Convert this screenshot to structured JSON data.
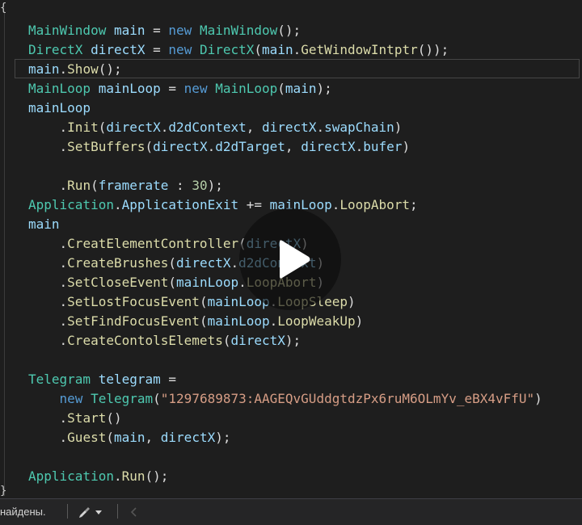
{
  "editor": {
    "lines": [
      {
        "id": "line-1",
        "current": false,
        "tokens": [
          {
            "c": "type",
            "t": "MainWindow"
          },
          {
            "c": "punc",
            "t": " "
          },
          {
            "c": "var",
            "t": "main"
          },
          {
            "c": "punc",
            "t": " = "
          },
          {
            "c": "kw",
            "t": "new"
          },
          {
            "c": "punc",
            "t": " "
          },
          {
            "c": "type",
            "t": "MainWindow"
          },
          {
            "c": "punc",
            "t": "();"
          }
        ]
      },
      {
        "id": "line-2",
        "current": false,
        "tokens": [
          {
            "c": "type",
            "t": "DirectX"
          },
          {
            "c": "punc",
            "t": " "
          },
          {
            "c": "var",
            "t": "directX"
          },
          {
            "c": "punc",
            "t": " = "
          },
          {
            "c": "kw",
            "t": "new"
          },
          {
            "c": "punc",
            "t": " "
          },
          {
            "c": "type",
            "t": "DirectX"
          },
          {
            "c": "punc",
            "t": "("
          },
          {
            "c": "var",
            "t": "main"
          },
          {
            "c": "punc",
            "t": "."
          },
          {
            "c": "meth",
            "t": "GetWindowIntptr"
          },
          {
            "c": "punc",
            "t": "());"
          }
        ]
      },
      {
        "id": "line-3",
        "current": true,
        "tokens": [
          {
            "c": "var",
            "t": "main"
          },
          {
            "c": "punc",
            "t": "."
          },
          {
            "c": "meth",
            "t": "Show"
          },
          {
            "c": "punc",
            "t": "();"
          }
        ]
      },
      {
        "id": "line-4",
        "current": false,
        "tokens": [
          {
            "c": "type",
            "t": "MainLoop"
          },
          {
            "c": "punc",
            "t": " "
          },
          {
            "c": "var",
            "t": "mainLoop"
          },
          {
            "c": "punc",
            "t": " = "
          },
          {
            "c": "kw",
            "t": "new"
          },
          {
            "c": "punc",
            "t": " "
          },
          {
            "c": "type",
            "t": "MainLoop"
          },
          {
            "c": "punc",
            "t": "("
          },
          {
            "c": "var",
            "t": "main"
          },
          {
            "c": "punc",
            "t": ");"
          }
        ]
      },
      {
        "id": "line-5",
        "current": false,
        "tokens": [
          {
            "c": "var",
            "t": "mainLoop"
          }
        ]
      },
      {
        "id": "line-6",
        "current": false,
        "tokens": [
          {
            "c": "punc",
            "t": "    ."
          },
          {
            "c": "meth",
            "t": "Init"
          },
          {
            "c": "punc",
            "t": "("
          },
          {
            "c": "var",
            "t": "directX"
          },
          {
            "c": "punc",
            "t": "."
          },
          {
            "c": "var",
            "t": "d2dContext"
          },
          {
            "c": "punc",
            "t": ", "
          },
          {
            "c": "var",
            "t": "directX"
          },
          {
            "c": "punc",
            "t": "."
          },
          {
            "c": "var",
            "t": "swapChain"
          },
          {
            "c": "punc",
            "t": ")"
          }
        ]
      },
      {
        "id": "line-7",
        "current": false,
        "tokens": [
          {
            "c": "punc",
            "t": "    ."
          },
          {
            "c": "meth",
            "t": "SetBuffers"
          },
          {
            "c": "punc",
            "t": "("
          },
          {
            "c": "var",
            "t": "directX"
          },
          {
            "c": "punc",
            "t": "."
          },
          {
            "c": "var",
            "t": "d2dTarget"
          },
          {
            "c": "punc",
            "t": ", "
          },
          {
            "c": "var",
            "t": "directX"
          },
          {
            "c": "punc",
            "t": "."
          },
          {
            "c": "var",
            "t": "bufer"
          },
          {
            "c": "punc",
            "t": ")"
          }
        ]
      },
      {
        "id": "line-8",
        "current": false,
        "tokens": []
      },
      {
        "id": "line-9",
        "current": false,
        "tokens": [
          {
            "c": "punc",
            "t": "    ."
          },
          {
            "c": "meth",
            "t": "Run"
          },
          {
            "c": "punc",
            "t": "("
          },
          {
            "c": "var",
            "t": "framerate"
          },
          {
            "c": "punc",
            "t": " : "
          },
          {
            "c": "num",
            "t": "30"
          },
          {
            "c": "punc",
            "t": ");"
          }
        ]
      },
      {
        "id": "line-10",
        "current": false,
        "tokens": [
          {
            "c": "type",
            "t": "Application"
          },
          {
            "c": "punc",
            "t": "."
          },
          {
            "c": "var",
            "t": "ApplicationExit"
          },
          {
            "c": "punc",
            "t": " += "
          },
          {
            "c": "var",
            "t": "mainLoop"
          },
          {
            "c": "punc",
            "t": "."
          },
          {
            "c": "meth",
            "t": "LoopAbort"
          },
          {
            "c": "punc",
            "t": ";"
          }
        ]
      },
      {
        "id": "line-11",
        "current": false,
        "tokens": [
          {
            "c": "var",
            "t": "main"
          }
        ]
      },
      {
        "id": "line-12",
        "current": false,
        "tokens": [
          {
            "c": "punc",
            "t": "    ."
          },
          {
            "c": "meth",
            "t": "CreatElementController"
          },
          {
            "c": "punc",
            "t": "("
          },
          {
            "c": "var",
            "t": "directX"
          },
          {
            "c": "punc",
            "t": ")"
          }
        ]
      },
      {
        "id": "line-13",
        "current": false,
        "tokens": [
          {
            "c": "punc",
            "t": "    ."
          },
          {
            "c": "meth",
            "t": "CreateBrushes"
          },
          {
            "c": "punc",
            "t": "("
          },
          {
            "c": "var",
            "t": "directX"
          },
          {
            "c": "punc",
            "t": "."
          },
          {
            "c": "var",
            "t": "d2dContext"
          },
          {
            "c": "punc",
            "t": ")"
          }
        ]
      },
      {
        "id": "line-14",
        "current": false,
        "tokens": [
          {
            "c": "punc",
            "t": "    ."
          },
          {
            "c": "meth",
            "t": "SetCloseEvent"
          },
          {
            "c": "punc",
            "t": "("
          },
          {
            "c": "var",
            "t": "mainLoop"
          },
          {
            "c": "punc",
            "t": "."
          },
          {
            "c": "meth",
            "t": "LoopAbort"
          },
          {
            "c": "punc",
            "t": ")"
          }
        ]
      },
      {
        "id": "line-15",
        "current": false,
        "tokens": [
          {
            "c": "punc",
            "t": "    ."
          },
          {
            "c": "meth",
            "t": "SetLostFocusEvent"
          },
          {
            "c": "punc",
            "t": "("
          },
          {
            "c": "var",
            "t": "mainLoop"
          },
          {
            "c": "punc",
            "t": "."
          },
          {
            "c": "meth",
            "t": "LoopSleep"
          },
          {
            "c": "punc",
            "t": ")"
          }
        ]
      },
      {
        "id": "line-16",
        "current": false,
        "tokens": [
          {
            "c": "punc",
            "t": "    ."
          },
          {
            "c": "meth",
            "t": "SetFindFocusEvent"
          },
          {
            "c": "punc",
            "t": "("
          },
          {
            "c": "var",
            "t": "mainLoop"
          },
          {
            "c": "punc",
            "t": "."
          },
          {
            "c": "meth",
            "t": "LoopWeakUp"
          },
          {
            "c": "punc",
            "t": ")"
          }
        ]
      },
      {
        "id": "line-17",
        "current": false,
        "tokens": [
          {
            "c": "punc",
            "t": "    ."
          },
          {
            "c": "meth",
            "t": "CreateContolsElemets"
          },
          {
            "c": "punc",
            "t": "("
          },
          {
            "c": "var",
            "t": "directX"
          },
          {
            "c": "punc",
            "t": ");"
          }
        ]
      },
      {
        "id": "line-18",
        "current": false,
        "tokens": []
      },
      {
        "id": "line-19",
        "current": false,
        "tokens": [
          {
            "c": "type",
            "t": "Telegram"
          },
          {
            "c": "punc",
            "t": " "
          },
          {
            "c": "var",
            "t": "telegram"
          },
          {
            "c": "punc",
            "t": " ="
          }
        ]
      },
      {
        "id": "line-20",
        "current": false,
        "tokens": [
          {
            "c": "punc",
            "t": "    "
          },
          {
            "c": "kw",
            "t": "new"
          },
          {
            "c": "punc",
            "t": " "
          },
          {
            "c": "type",
            "t": "Telegram"
          },
          {
            "c": "punc",
            "t": "("
          },
          {
            "c": "str",
            "t": "\"1297689873:AAGEQvGUddgtdzPx6ruM6OLmYv_eBX4vFfU\""
          },
          {
            "c": "punc",
            "t": ")"
          }
        ]
      },
      {
        "id": "line-21",
        "current": false,
        "tokens": [
          {
            "c": "punc",
            "t": "    ."
          },
          {
            "c": "meth",
            "t": "Start"
          },
          {
            "c": "punc",
            "t": "()"
          }
        ]
      },
      {
        "id": "line-22",
        "current": false,
        "tokens": [
          {
            "c": "punc",
            "t": "    ."
          },
          {
            "c": "meth",
            "t": "Guest"
          },
          {
            "c": "punc",
            "t": "("
          },
          {
            "c": "var",
            "t": "main"
          },
          {
            "c": "punc",
            "t": ", "
          },
          {
            "c": "var",
            "t": "directX"
          },
          {
            "c": "punc",
            "t": ");"
          }
        ]
      },
      {
        "id": "line-23",
        "current": false,
        "tokens": []
      },
      {
        "id": "line-24",
        "current": false,
        "tokens": [
          {
            "c": "type",
            "t": "Application"
          },
          {
            "c": "punc",
            "t": "."
          },
          {
            "c": "meth",
            "t": "Run"
          },
          {
            "c": "punc",
            "t": "();"
          }
        ]
      }
    ],
    "open_brace": "{",
    "close_brace": "}"
  },
  "status_bar": {
    "message": "найдены.",
    "tool_icon": "brush-icon",
    "dropdown_icon": "caret-down-icon",
    "scroll_icon": "caret-left-icon"
  },
  "overlay": {
    "icon": "play-icon"
  },
  "colors": {
    "background": "#1e1e1e",
    "type": "#4ec9b0",
    "variable": "#9cdcfe",
    "keyword": "#569cd6",
    "method": "#dcdcaa",
    "number": "#b5cea8",
    "string": "#d69d85",
    "text": "#dcdcdc",
    "status_bar": "#252526"
  }
}
